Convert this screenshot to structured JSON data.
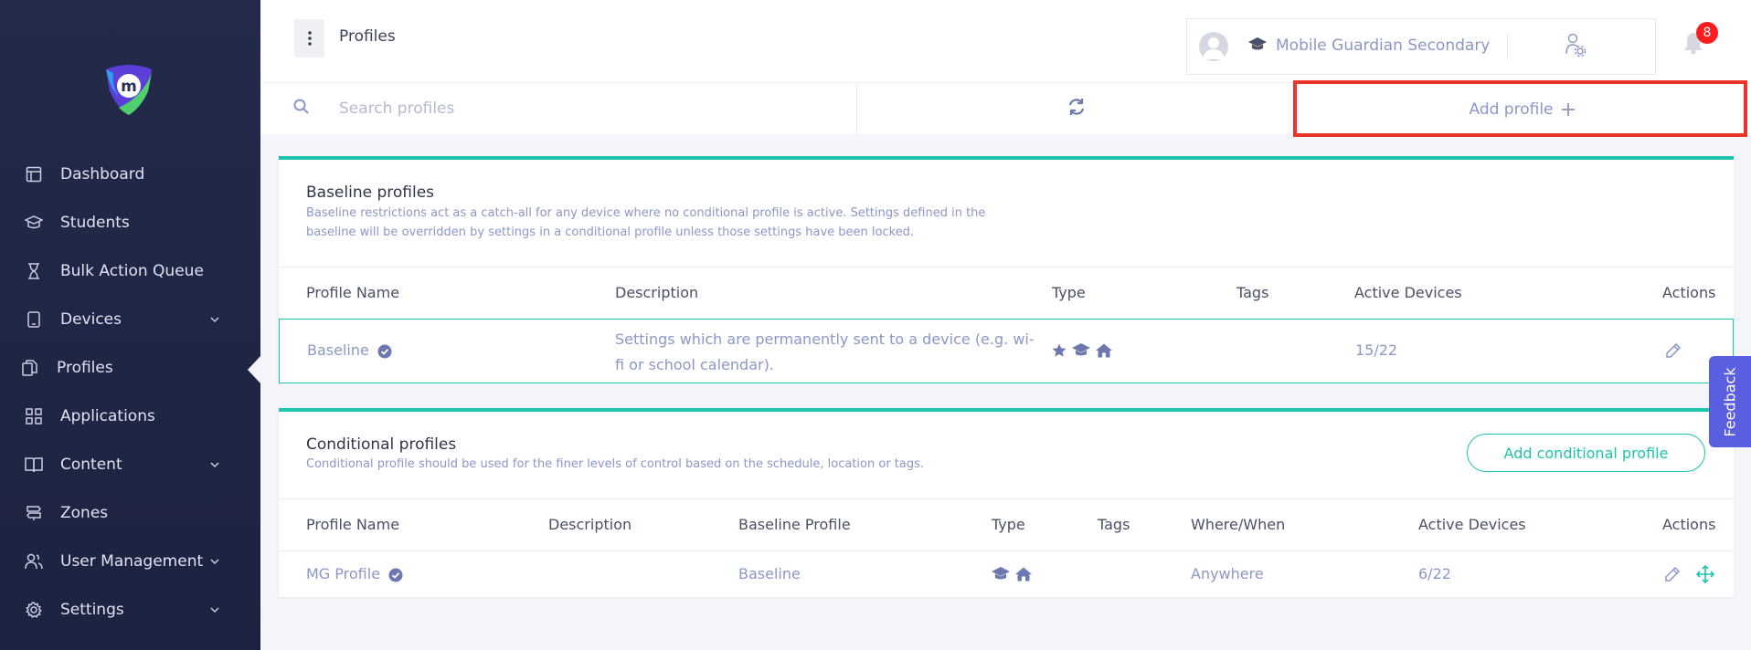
{
  "sidebar": {
    "items": [
      {
        "label": "Dashboard",
        "icon": "dashboard-icon",
        "has_submenu": false
      },
      {
        "label": "Students",
        "icon": "graduation-cap-icon",
        "has_submenu": false
      },
      {
        "label": "Bulk Action Queue",
        "icon": "hourglass-icon",
        "has_submenu": false
      },
      {
        "label": "Devices",
        "icon": "tablet-icon",
        "has_submenu": true
      },
      {
        "label": "Profiles",
        "icon": "copy-icon",
        "has_submenu": false,
        "active": true
      },
      {
        "label": "Applications",
        "icon": "grid-icon",
        "has_submenu": false
      },
      {
        "label": "Content",
        "icon": "book-icon",
        "has_submenu": true
      },
      {
        "label": "Zones",
        "icon": "signpost-icon",
        "has_submenu": false
      },
      {
        "label": "User Management",
        "icon": "users-icon",
        "has_submenu": true
      },
      {
        "label": "Settings",
        "icon": "gear-icon",
        "has_submenu": true
      }
    ]
  },
  "header": {
    "title": "Profiles",
    "school_name": "Mobile Guardian Secondary",
    "notification_count": "8"
  },
  "toolbar": {
    "search_placeholder": "Search profiles",
    "add_profile_label": "Add profile"
  },
  "baseline": {
    "title": "Baseline profiles",
    "description": "Baseline restrictions act as a catch-all for any device where no conditional profile is active. Settings defined in the baseline will be overridden by settings in a conditional profile unless those settings have been locked.",
    "columns": [
      "Profile Name",
      "Description",
      "Type",
      "Tags",
      "Active Devices",
      "Actions"
    ],
    "rows": [
      {
        "name": "Baseline",
        "description": "Settings which are permanently sent to a device (e.g. wi-fi or school calendar).",
        "type_icons": [
          "star-icon",
          "graduation-cap-icon",
          "home-icon"
        ],
        "tags": "",
        "active_devices": "15/22"
      }
    ]
  },
  "conditional": {
    "title": "Conditional profiles",
    "description": "Conditional profile should be used for the finer levels of control based on the schedule, location or tags.",
    "add_label": "Add conditional profile",
    "columns": [
      "Profile Name",
      "Description",
      "Baseline Profile",
      "Type",
      "Tags",
      "Where/When",
      "Active Devices",
      "Actions"
    ],
    "rows": [
      {
        "name": "MG Profile",
        "description": "",
        "baseline_profile": "Baseline",
        "type_icons": [
          "graduation-cap-icon",
          "home-icon"
        ],
        "tags": "",
        "where_when": "Anywhere",
        "active_devices": "6/22"
      }
    ]
  },
  "feedback_label": "Feedback",
  "colors": {
    "accent": "#1ec4ac",
    "sidebar_bg": "#232a4a",
    "link": "#8c97c8",
    "badge": "#ff1c1c",
    "highlight": "#e8342b",
    "feedback": "#5a5fe0"
  }
}
